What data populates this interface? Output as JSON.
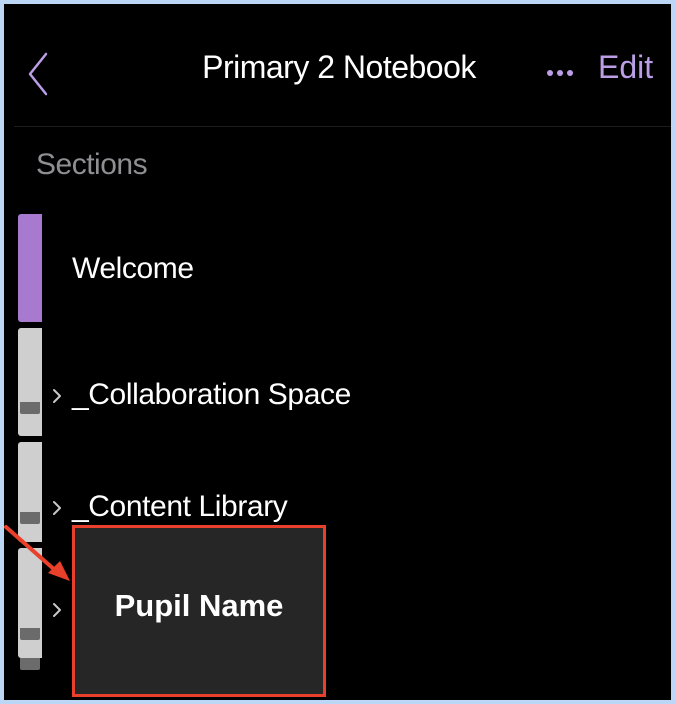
{
  "nav": {
    "title": "Primary 2 Notebook",
    "more_label": "•••",
    "edit_label": "Edit"
  },
  "sections_heading": "Sections",
  "sections": [
    {
      "label": "Welcome",
      "color": "#a779cf",
      "expandable": false
    },
    {
      "label": "_Collaboration Space",
      "color": "#cfcfcf",
      "expandable": true
    },
    {
      "label": "_Content Library",
      "color": "#cfcfcf",
      "expandable": true
    },
    {
      "label": "",
      "color": "#cfcfcf",
      "expandable": true
    }
  ],
  "annotation": {
    "text": "Pupil Name",
    "border_color": "#e8402a",
    "arrow_color": "#e8402a"
  },
  "colors": {
    "accent": "#bb9ee6",
    "background": "#000000",
    "frame": "#bcd7f5"
  },
  "icons": {
    "back": "chevron-left-icon",
    "more": "more-horizontal-icon",
    "expand": "chevron-right-icon"
  }
}
